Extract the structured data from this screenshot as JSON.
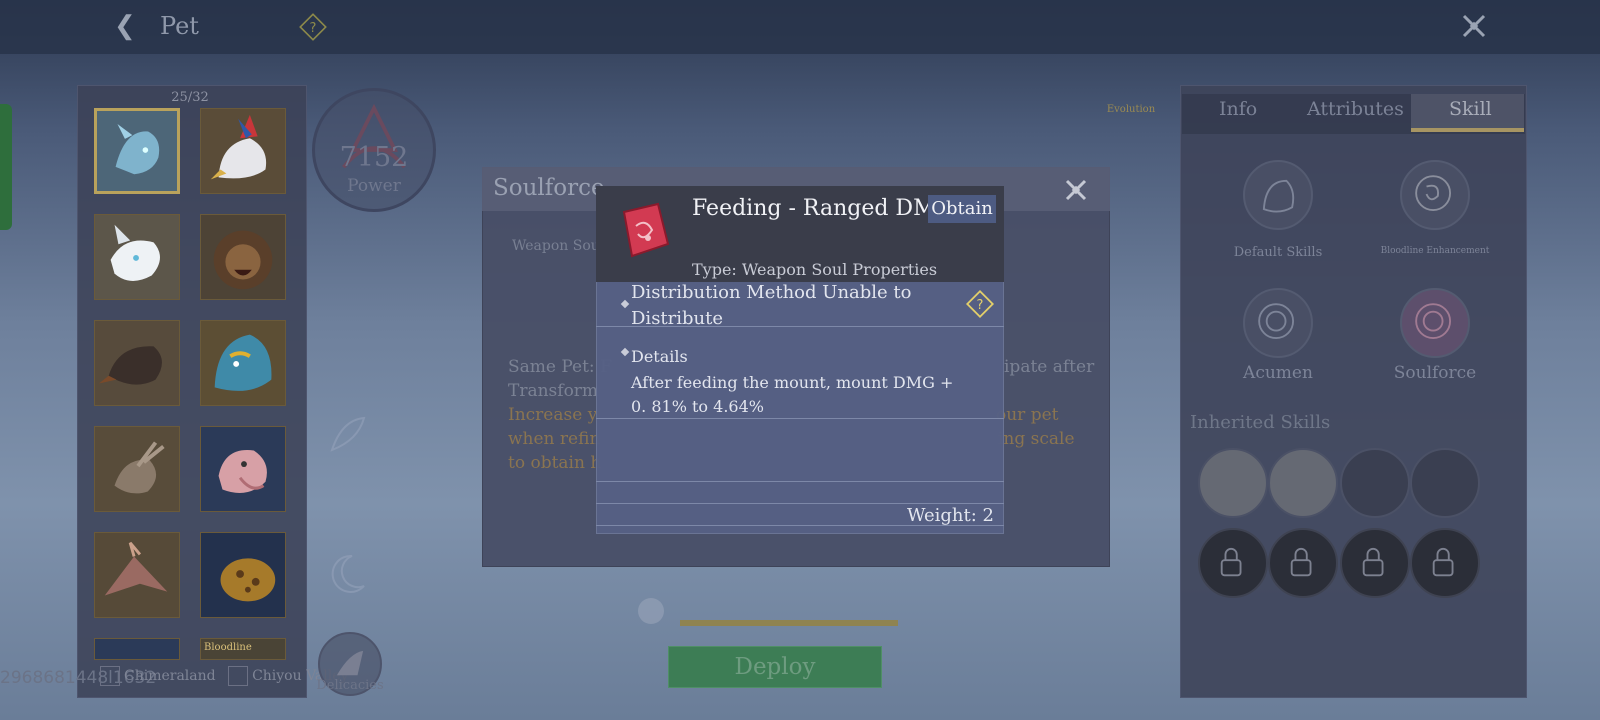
{
  "header": {
    "title": "Pet"
  },
  "pet_list": {
    "count": "25/32",
    "slots": [
      "wolf-spirit",
      "eagle",
      "frost-fox",
      "lion",
      "raven",
      "blue-beast",
      "mantis",
      "pink-bird",
      "dragon-wing",
      "spotted-shell"
    ],
    "filters": [
      {
        "label": "Chimeraland"
      },
      {
        "label": "Chiyou Valley"
      }
    ],
    "bottom_tag": "Bloodline"
  },
  "uid": "2968681448l1632",
  "power": {
    "value": "7152",
    "label": "Power"
  },
  "delicacies_label": "Delicacies",
  "evolution_badge": "Evolution",
  "deploy_label": "Deploy",
  "right_panel": {
    "tabs": [
      "Info",
      "Attributes",
      "Skill"
    ],
    "active_tab": "Skill",
    "skills": [
      {
        "label": "Default Skills"
      },
      {
        "label": "Bloodline Enhancement"
      },
      {
        "label": "Acumen"
      },
      {
        "label": "Soulforce"
      }
    ],
    "inherited_title": "Inherited Skills"
  },
  "soulforce_modal": {
    "title": "Soulforce",
    "weapon_soul_label": "Weapon Sou",
    "desc_left": [
      "Same Pet: F",
      "Transform",
      "Increase y",
      "when refin",
      "to obtain h"
    ],
    "desc_right": [
      "ipate after",
      "our pet",
      "ing scale"
    ]
  },
  "tooltip": {
    "title": "Feeding - Ranged DMG",
    "obtain_label": "Obtain",
    "type": "Type: Weapon Soul Properties",
    "distribution": "Distribution Method   Unable to Distribute",
    "details_label": "Details",
    "details_text": "After feeding the mount, mount DMG + 0. 81% to 4.64%",
    "weight": "Weight: 2"
  },
  "colors": {
    "accent_gold": "#b9a25c",
    "deploy_green": "#3d7d55",
    "tooltip_bg": "#56608a",
    "item_red": "#d23a52"
  }
}
